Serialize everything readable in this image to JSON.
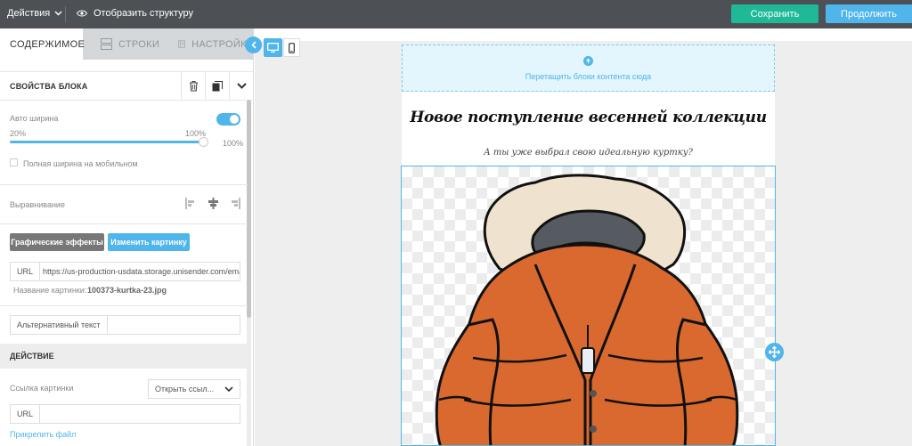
{
  "topbar": {
    "actions_label": "Действия",
    "structure_label": "Отобразить структуру",
    "save_label": "Сохранить",
    "next_label": "Продолжить"
  },
  "tabs": [
    {
      "label": "СОДЕРЖИМОЕ",
      "icon": "grid-icon",
      "active": true
    },
    {
      "label": "СТРОКИ",
      "icon": "rows-icon",
      "active": false
    },
    {
      "label": "НАСТРОЙКИ",
      "icon": "settings-icon",
      "active": false
    }
  ],
  "block_props": {
    "title": "СВОЙСТВА БЛОКА",
    "auto_width_label": "Авто ширина",
    "auto_width_on": true,
    "slider_min": "20%",
    "slider_max": "100%",
    "slider_value": "100%",
    "full_width_mobile_label": "Полная ширина на мобильном",
    "alignment_label": "Выравнивание",
    "effects_button": "Графические эффекты",
    "change_image_button": "Изменить картинку",
    "url_label": "URL",
    "url_value": "https://us-production-usdata.storage.unisender.com/emai",
    "image_name_label": "Название картинки:",
    "image_name_value": "100373-kurtka-23.jpg",
    "alt_text_label": "Альтернативный текст",
    "alt_text_value": ""
  },
  "action": {
    "title": "ДЕЙСТВИЕ",
    "link_label": "Ссылка картинки",
    "link_select_value": "Открыть ссыл...",
    "url_label": "URL",
    "url_value": "",
    "attach_label": "Прикрепить файл"
  },
  "canvas": {
    "dropzone_text": "Перетащить блоки контента сюда",
    "headline": "Новое поступление весенней коллекции",
    "subheadline": "А ты уже выбрал свою идеальную куртку?"
  },
  "colors": {
    "accent": "#4fb5eb",
    "save": "#1fb998",
    "topbar": "#4d5156",
    "jacket": "#d9692f"
  }
}
